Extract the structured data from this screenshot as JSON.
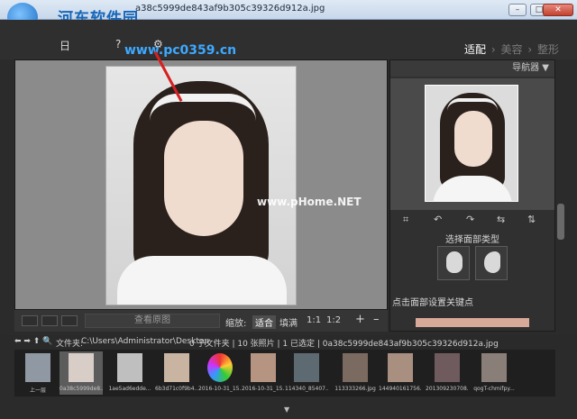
{
  "window": {
    "title": "a38c5999de843af9b305c39326d912a.jpg",
    "watermark_text": "河东软件园",
    "watermark_url": "www.pc0359.cn",
    "buttons": {
      "minimize": "–",
      "maximize": "□",
      "close": "✕"
    }
  },
  "toolbar": {
    "icons": [
      "save-icon",
      "help-icon",
      "settings-icon"
    ],
    "labels": {
      "save": "日",
      "help": "?",
      "settings": "⚙"
    },
    "modes": [
      "适配",
      "美容",
      "整形"
    ],
    "mode_separator": "›",
    "active_mode": "适配"
  },
  "viewer": {
    "image_watermark": "www.pHome.NET",
    "view_original_label": "查看原图",
    "zoom_label": "缩放:",
    "fit_label": "适合",
    "fill_label": "填满",
    "ratio_1_1": "1:1",
    "ratio_1_2": "1:2",
    "zoom_in": "+",
    "zoom_out": "–"
  },
  "panel": {
    "navigator_label": "导航器 ▼",
    "tools": [
      "crop-icon",
      "rotate-left-icon",
      "rotate-right-icon",
      "flip-horizontal-icon",
      "flip-vertical-icon"
    ],
    "tool_glyphs": [
      "⌗",
      "↶",
      "↷",
      "⇆",
      "⇅"
    ],
    "face_type_label": "选择面部类型",
    "click_face_label": "点击面部设置关键点"
  },
  "path_bar": {
    "nav_glyphs": "⬅ ➡ ⬆ 🔍",
    "folder_label": "文件夹:",
    "path": "C:\\Users\\Administrator\\Desktop",
    "summary": "0 子文件夹 | 10 张照片 | 1 已选定 | 0a38c5999de843af9b305c39326d912a.jpg"
  },
  "filmstrip": {
    "items": [
      {
        "label": "上一层",
        "kind": "up-folder"
      },
      {
        "label": "0a38c5999de8...",
        "kind": "photo",
        "selected": true
      },
      {
        "label": "1ae5ad6edde...",
        "kind": "photo"
      },
      {
        "label": "6b3d71c0f9b4...",
        "kind": "photo"
      },
      {
        "label": "2016-10-31_15...",
        "kind": "photo"
      },
      {
        "label": "2016-10-31_15...",
        "kind": "photo"
      },
      {
        "label": "114340_85407...",
        "kind": "photo"
      },
      {
        "label": "113333266.jpg",
        "kind": "photo"
      },
      {
        "label": "144940161756...",
        "kind": "photo"
      },
      {
        "label": "201309230708...",
        "kind": "photo"
      },
      {
        "label": "qogT-chmifpy...",
        "kind": "photo"
      }
    ]
  }
}
